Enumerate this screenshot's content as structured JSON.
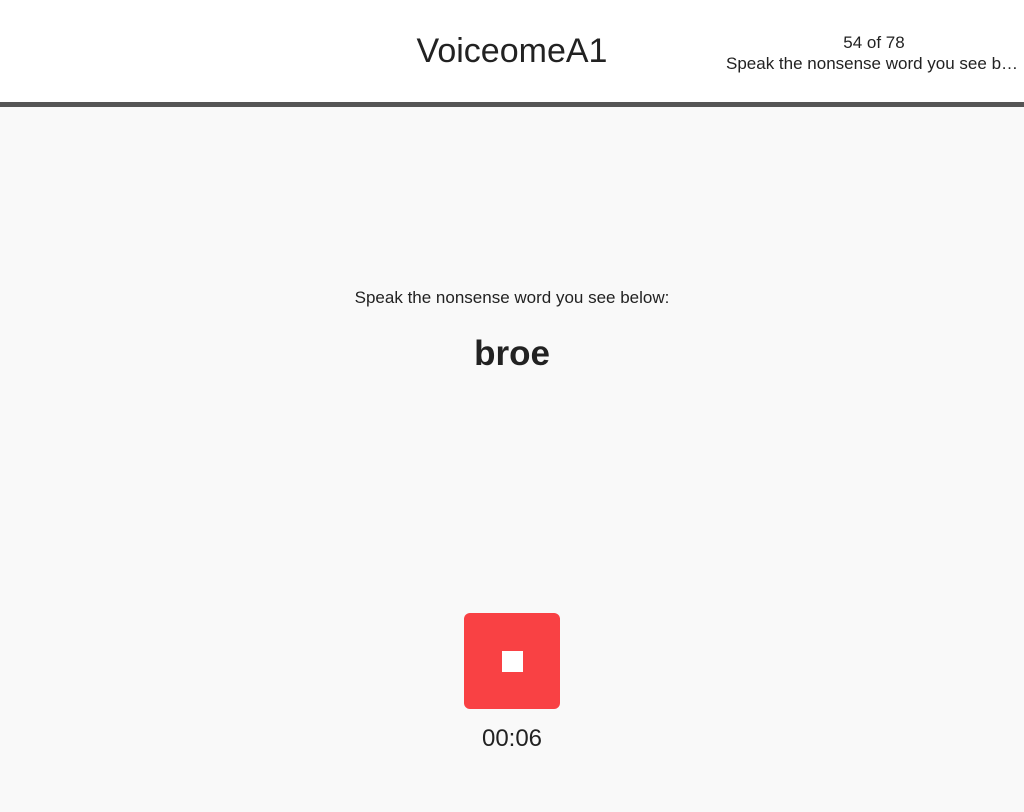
{
  "header": {
    "title": "VoiceomeA1",
    "step_counter": "54 of 78",
    "step_description": "Speak the nonsense word you see below:",
    "progress": {
      "current": 54,
      "total": 78
    }
  },
  "task": {
    "prompt": "Speak the nonsense word you see below:",
    "word": "broe"
  },
  "recorder": {
    "button_icon": "stop-icon",
    "button_color": "#f94144",
    "elapsed": "00:06"
  }
}
